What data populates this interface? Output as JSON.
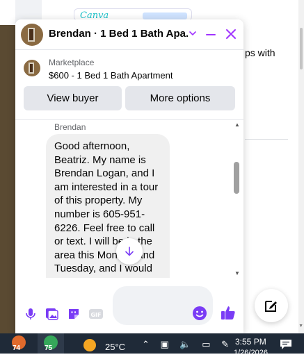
{
  "chat": {
    "title": "Brendan · 1 Bed 1 Bath Apa...",
    "marketplace_label": "Marketplace",
    "listing_title": "$600 - 1 Bed 1 Bath Apartment",
    "view_buyer_label": "View buyer",
    "more_options_label": "More options",
    "sender_name": "Brendan",
    "message_text": "Good afternoon, Beatriz. My name is Brendan Logan, and I am interested in a tour of this property. My number is 605-951-6226. Feel free to call or text. I will be in the area this Monday and Tuesday, and I would like to tour of this property."
  },
  "background": {
    "partial_text": "ps with",
    "canva_logo": "Canva"
  },
  "taskbar": {
    "app1_badge": "74",
    "app2_badge": "75",
    "temperature": "25°C",
    "time": "3:55 PM",
    "date": "1/26/2026"
  },
  "colors": {
    "accent": "#a033ff",
    "bubble": "#f0f0f0",
    "taskbar": "#1f2a38"
  }
}
